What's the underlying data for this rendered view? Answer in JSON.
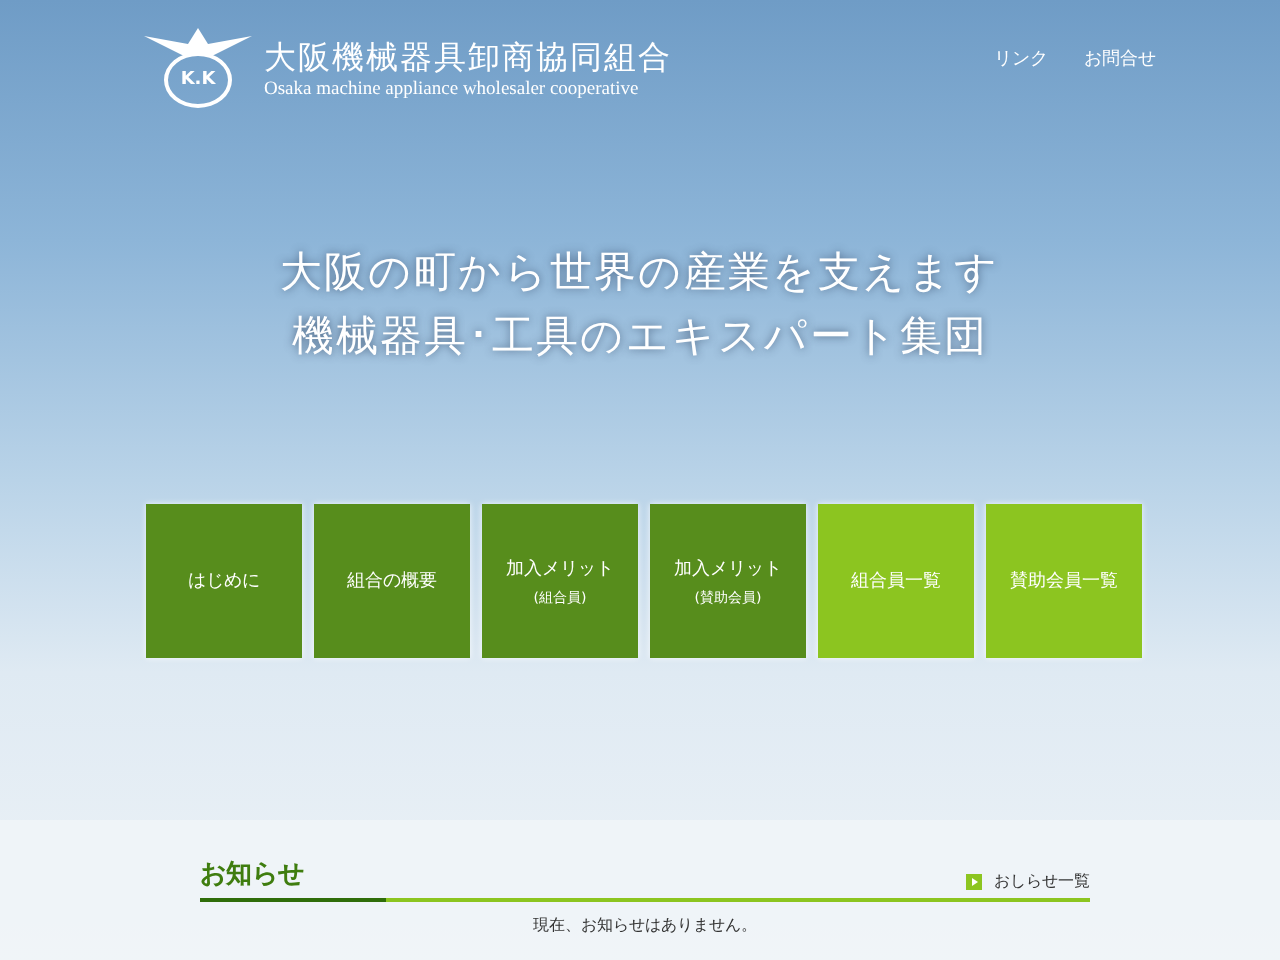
{
  "header": {
    "logo_mark": "K.K",
    "title": "大阪機械器具卸商協同組合",
    "subtitle": "Osaka machine appliance wholesaler cooperative",
    "nav": [
      "リンク",
      "お問合せ"
    ]
  },
  "hero": {
    "lines": [
      "大阪の町から世界の産業を支えます",
      "機械器具･工具のエキスパート集団"
    ]
  },
  "tiles": [
    {
      "label": "はじめに",
      "color": "#578d1c"
    },
    {
      "label": "組合の概要",
      "color": "#578d1c"
    },
    {
      "label": "加入メリット",
      "sub": "(組合員)",
      "color": "#578d1c"
    },
    {
      "label": "加入メリット",
      "sub": "(賛助会員)",
      "color": "#578d1c"
    },
    {
      "label": "組合員一覧",
      "color": "#8cc520"
    },
    {
      "label": "賛助会員一覧",
      "color": "#8cc520"
    }
  ],
  "news": {
    "title": "お知らせ",
    "more": "おしらせ一覧",
    "message": "現在、お知らせはありません。"
  }
}
